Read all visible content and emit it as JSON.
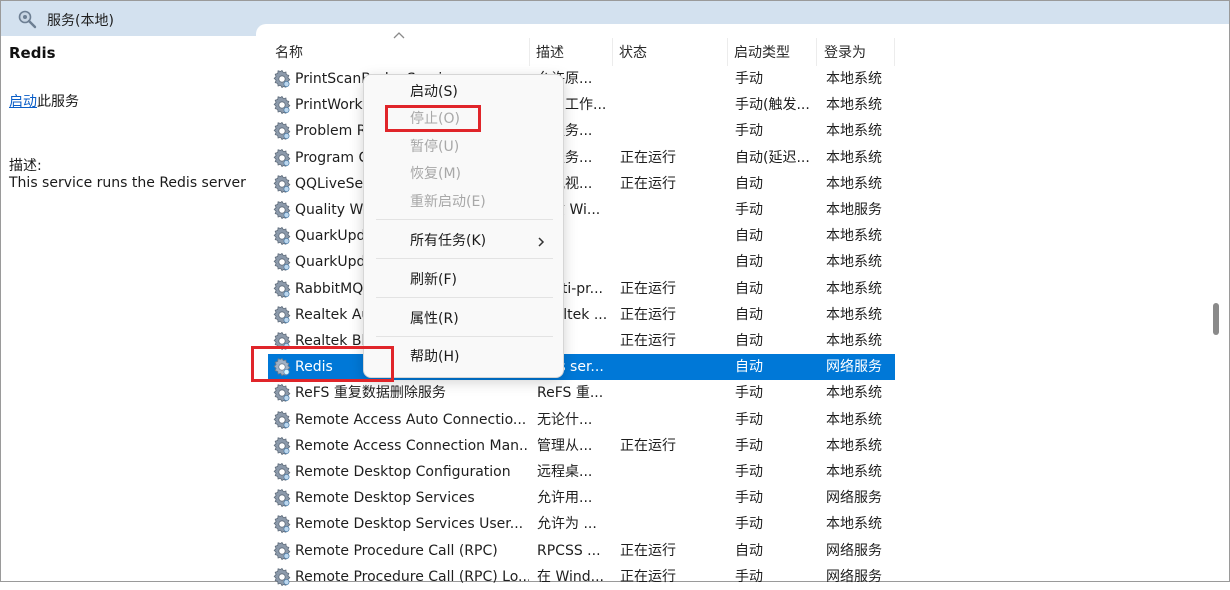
{
  "window": {
    "title": "服务(本地)"
  },
  "left_panel": {
    "service_name": "Redis",
    "start_link": "启动",
    "start_suffix": "此服务",
    "description_label": "描述:",
    "description": "This service runs the Redis server"
  },
  "columns": [
    "名称",
    "描述",
    "状态",
    "启动类型",
    "登录为"
  ],
  "rows": [
    {
      "name": "PrintScanBrokerService",
      "desc": "允许原...",
      "status": "",
      "startup": "手动",
      "logon": "本地系统"
    },
    {
      "name": "PrintWorkflow",
      "desc": "打印工作...",
      "status": "",
      "startup": "手动(触发...",
      "logon": "本地系统"
    },
    {
      "name": "Problem Reports Control Panel Support",
      "desc": "此服务...",
      "status": "",
      "startup": "手动",
      "logon": "本地系统"
    },
    {
      "name": "Program Compatibility Assistant",
      "desc": "此服务...",
      "status": "正在运行",
      "startup": "自动(延迟...",
      "logon": "本地系统"
    },
    {
      "name": "QQLiveService",
      "desc": "腾讯视...",
      "status": "正在运行",
      "startup": "自动",
      "logon": "本地系统"
    },
    {
      "name": "Quality Windows Audio Video",
      "desc": "优质 Wi...",
      "status": "",
      "startup": "手动",
      "logon": "本地服务"
    },
    {
      "name": "QuarkUpdateService",
      "desc": "",
      "status": "",
      "startup": "自动",
      "logon": "本地系统"
    },
    {
      "name": "QuarkUpdateService",
      "desc": "",
      "status": "",
      "startup": "自动",
      "logon": "本地系统"
    },
    {
      "name": "RabbitMQ",
      "desc": "Multi-pr...",
      "status": "正在运行",
      "startup": "自动",
      "logon": "本地系统"
    },
    {
      "name": "Realtek Audio Service",
      "desc": "Realtek ...",
      "status": "正在运行",
      "startup": "自动",
      "logon": "本地系统"
    },
    {
      "name": "Realtek Bluetooth",
      "desc": "",
      "status": "正在运行",
      "startup": "自动",
      "logon": "本地系统"
    },
    {
      "name": "Redis",
      "desc": "This ser...",
      "status": "",
      "startup": "自动",
      "logon": "网络服务"
    },
    {
      "name": "ReFS 重复数据删除服务",
      "desc": "ReFS 重...",
      "status": "",
      "startup": "手动",
      "logon": "本地系统"
    },
    {
      "name": "Remote Access Auto Connectio...",
      "desc": "无论什...",
      "status": "",
      "startup": "手动",
      "logon": "本地系统"
    },
    {
      "name": "Remote Access Connection Man...",
      "desc": "管理从...",
      "status": "正在运行",
      "startup": "手动",
      "logon": "本地系统"
    },
    {
      "name": "Remote Desktop Configuration",
      "desc": "远程桌...",
      "status": "",
      "startup": "手动",
      "logon": "本地系统"
    },
    {
      "name": "Remote Desktop Services",
      "desc": "允许用...",
      "status": "",
      "startup": "手动",
      "logon": "网络服务"
    },
    {
      "name": "Remote Desktop Services User...",
      "desc": "允许为 ...",
      "status": "",
      "startup": "手动",
      "logon": "本地系统"
    },
    {
      "name": "Remote Procedure Call (RPC)",
      "desc": "RPCSS ...",
      "status": "正在运行",
      "startup": "自动",
      "logon": "网络服务"
    },
    {
      "name": "Remote Procedure Call (RPC) Lo...",
      "desc": "在 Wind...",
      "status": "正在运行",
      "startup": "手动",
      "logon": "网络服务"
    }
  ],
  "context_menu": {
    "start": "启动(S)",
    "stop": "停止(O)",
    "pause": "暂停(U)",
    "resume": "恢复(M)",
    "restart": "重新启动(E)",
    "all_tasks": "所有任务(K)",
    "refresh": "刷新(F)",
    "properties": "属性(R)",
    "help": "帮助(H)"
  },
  "colors": {
    "selection": "#0078d7",
    "highlight_box": "#e0252a",
    "titlebar": "#d3e1ef",
    "link": "#0a5ec8"
  }
}
